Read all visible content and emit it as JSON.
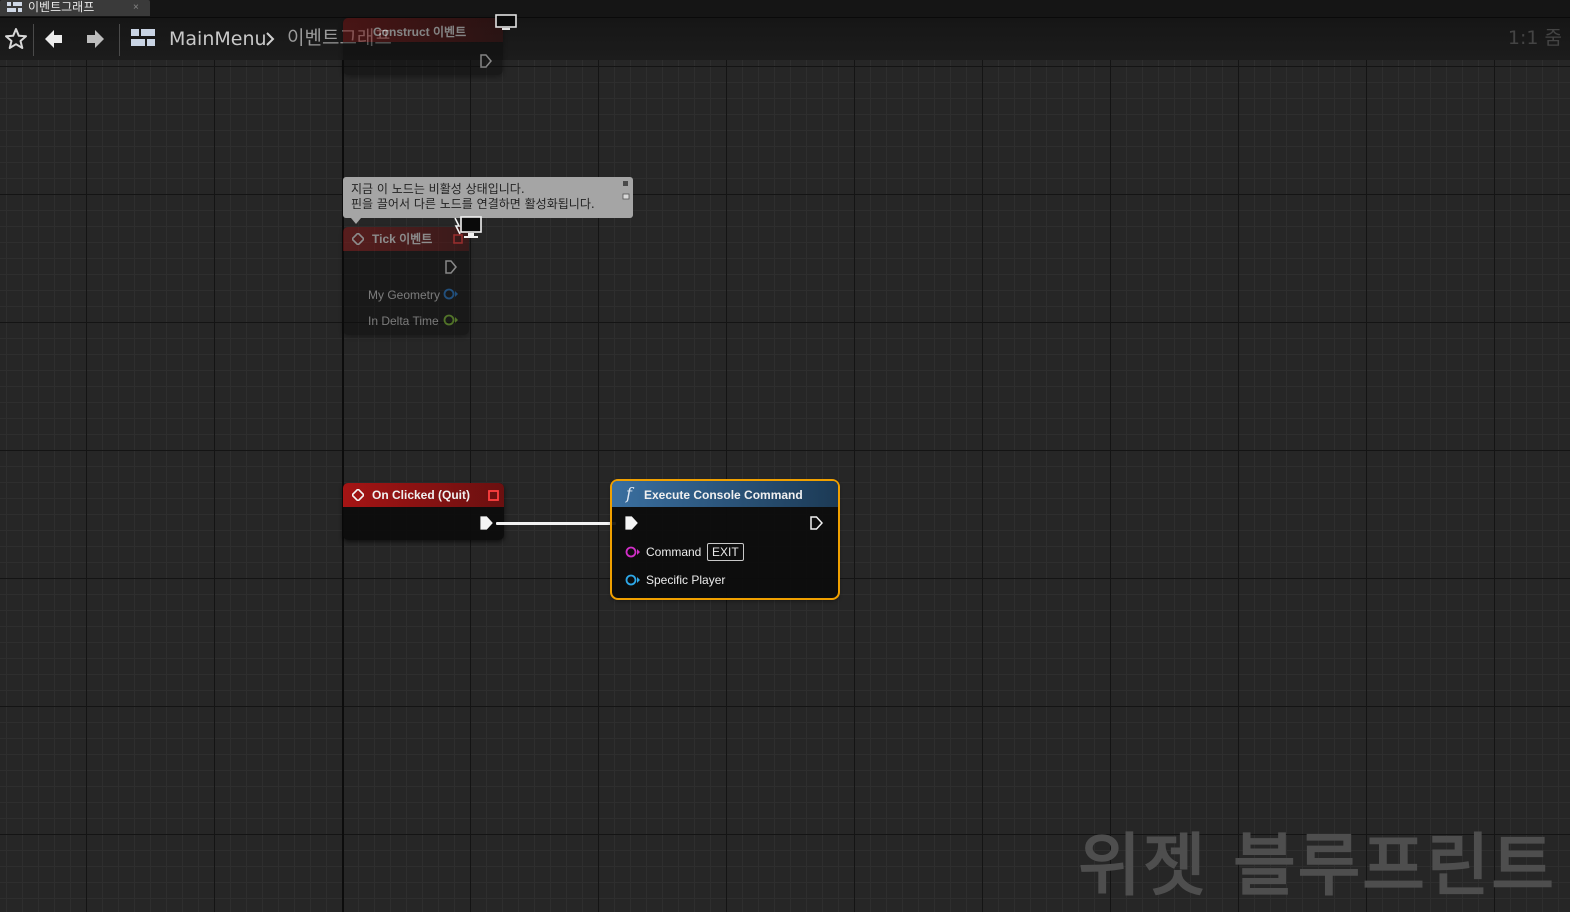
{
  "tab": {
    "label": "이벤트그래프",
    "close": "×"
  },
  "breadcrumb": {
    "blueprint": "MainMenu",
    "graph": "이벤트그래프"
  },
  "zoom": "1:1 줌",
  "nodes": {
    "construct": {
      "title": "Construct 이벤트"
    },
    "tick": {
      "title": "Tick 이벤트",
      "pins": {
        "geometry": "My Geometry",
        "delta": "In Delta Time"
      }
    },
    "on_clicked": {
      "title": "On Clicked (Quit)"
    },
    "execute": {
      "title": "Execute Console Command",
      "pins": {
        "command": "Command",
        "command_value": "EXIT",
        "player": "Specific Player"
      }
    }
  },
  "comment": {
    "line1": "지금 이 노드는 비활성 상태입니다.",
    "line2": "핀을 끌어서 다른 노드를 연결하면 활성화됩니다."
  },
  "watermark": "위젯 블루프린트",
  "colors": {
    "event_header": "#a51414",
    "function_header": "#3a6fa0",
    "selection": "#f0a000",
    "pin_struct": "#1e78d2",
    "pin_float": "#7ec12c",
    "pin_string": "#d22ec8",
    "pin_object": "#2ea8e8"
  }
}
